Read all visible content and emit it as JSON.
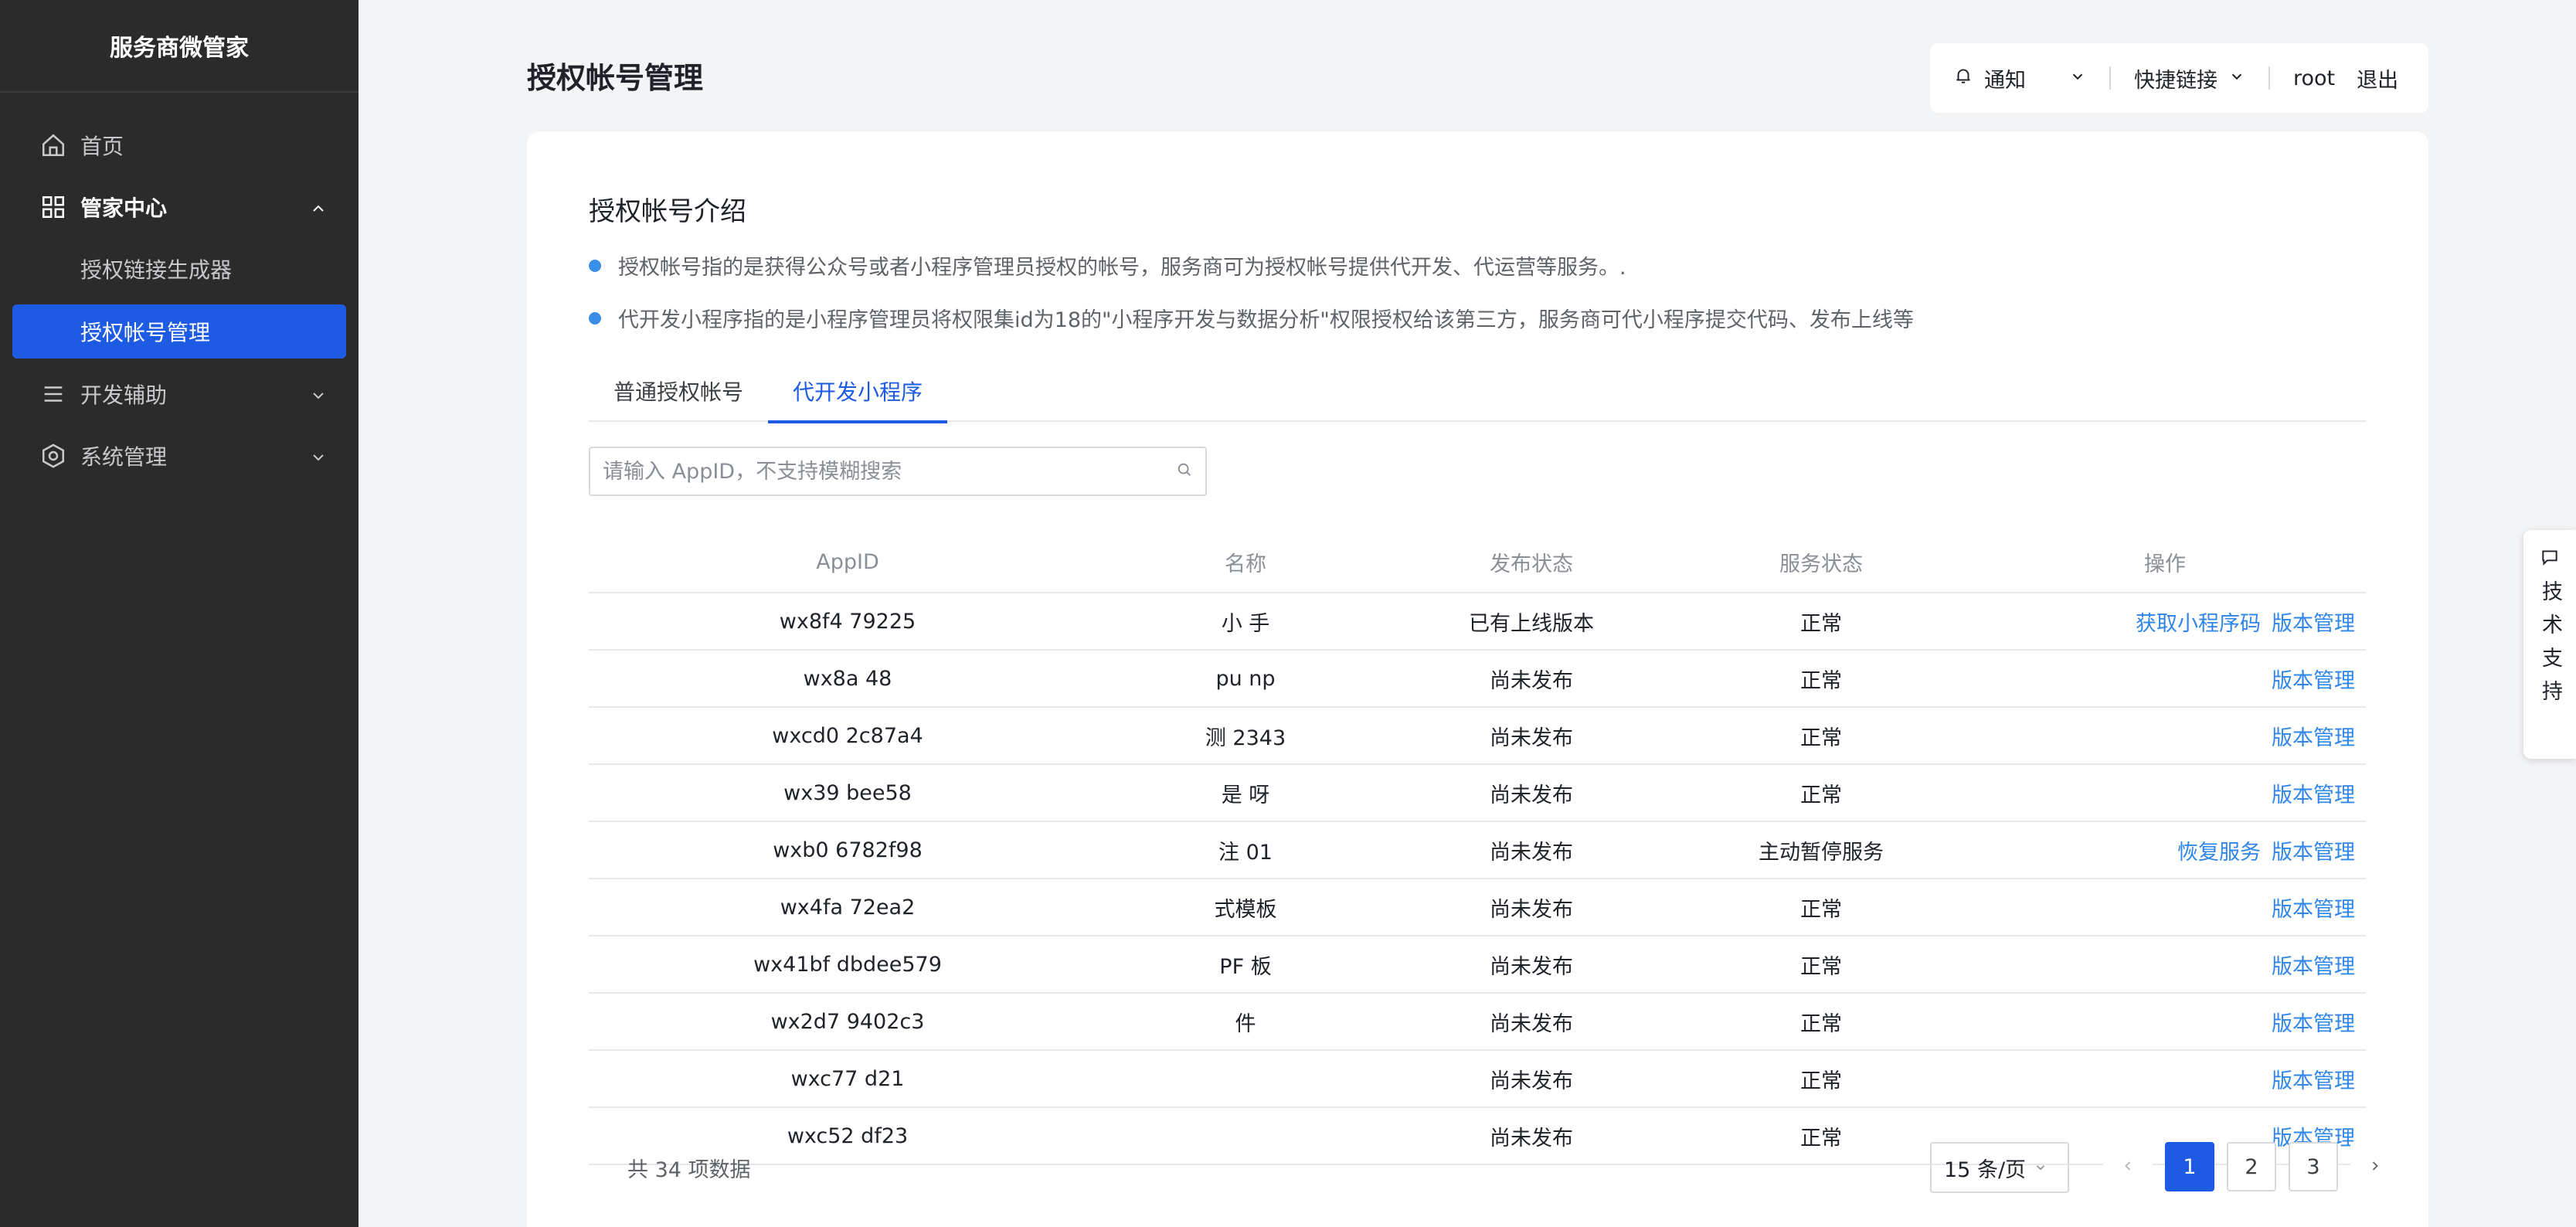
{
  "app": {
    "brand": "服务商微管家"
  },
  "sidebar": {
    "items": [
      {
        "label": "首页",
        "icon": "home-icon"
      },
      {
        "label": "管家中心",
        "icon": "grid-icon",
        "expanded": true
      },
      {
        "label": "授权链接生成器"
      },
      {
        "label": "授权帐号管理",
        "selected": true
      },
      {
        "label": "开发辅助",
        "icon": "list-icon"
      },
      {
        "label": "系统管理",
        "icon": "hexagon-gear-icon"
      }
    ]
  },
  "header": {
    "title": "授权帐号管理",
    "notice_label": "通知",
    "quicklink_label": "快捷链接",
    "user": "root",
    "logout": "退出"
  },
  "intro": {
    "title": "授权帐号介绍",
    "bullets": [
      "授权帐号指的是获得公众号或者小程序管理员授权的帐号，服务商可为授权帐号提供代开发、代运营等服务。.",
      "代开发小程序指的是小程序管理员将权限集id为18的\"小程序开发与数据分析\"权限授权给该第三方，服务商可代小程序提交代码、发布上线等"
    ]
  },
  "tabs": [
    "普通授权帐号",
    "代开发小程序"
  ],
  "active_tab": 1,
  "search": {
    "placeholder": "请输入 AppID，不支持模糊搜索",
    "value": ""
  },
  "table": {
    "columns": [
      "AppID",
      "名称",
      "发布状态",
      "服务状态",
      "操作"
    ],
    "rows": [
      {
        "appid": "wx8f4   79225",
        "name": "小   手",
        "publish": "已有上线版本",
        "service": "正常",
        "ops": [
          "获取小程序码",
          "版本管理"
        ]
      },
      {
        "appid": "wx8a   48",
        "name": "pu   np",
        "publish": "尚未发布",
        "service": "正常",
        "ops": [
          "版本管理"
        ]
      },
      {
        "appid": "wxcd0   2c87a4",
        "name": "测   2343",
        "publish": "尚未发布",
        "service": "正常",
        "ops": [
          "版本管理"
        ]
      },
      {
        "appid": "wx39   bee58",
        "name": "是   呀",
        "publish": "尚未发布",
        "service": "正常",
        "ops": [
          "版本管理"
        ]
      },
      {
        "appid": "wxb0   6782f98",
        "name": "注   01",
        "publish": "尚未发布",
        "service": "主动暂停服务",
        "ops": [
          "恢复服务",
          "版本管理"
        ]
      },
      {
        "appid": "wx4fa   72ea2",
        "name": "式模板",
        "publish": "尚未发布",
        "service": "正常",
        "ops": [
          "版本管理"
        ]
      },
      {
        "appid": "wx41bf   dbdee579",
        "name": "PF   板",
        "publish": "尚未发布",
        "service": "正常",
        "ops": [
          "版本管理"
        ]
      },
      {
        "appid": "wx2d7   9402c3",
        "name": "件",
        "publish": "尚未发布",
        "service": "正常",
        "ops": [
          "版本管理"
        ]
      },
      {
        "appid": "wxc77   d21",
        "name": "",
        "publish": "尚未发布",
        "service": "正常",
        "ops": [
          "版本管理"
        ]
      },
      {
        "appid": "wxc52   df23",
        "name": "",
        "publish": "尚未发布",
        "service": "正常",
        "ops": [
          "版本管理"
        ]
      }
    ]
  },
  "footer": {
    "total": "共 34 项数据",
    "page_size": "15 条/页",
    "pages": [
      "1",
      "2",
      "3"
    ],
    "current_page": 1
  },
  "support": {
    "label": "技术支持"
  },
  "colors": {
    "sidebar": "#2b2b2b",
    "accent": "#1d5be3",
    "link": "#2f86e8"
  }
}
